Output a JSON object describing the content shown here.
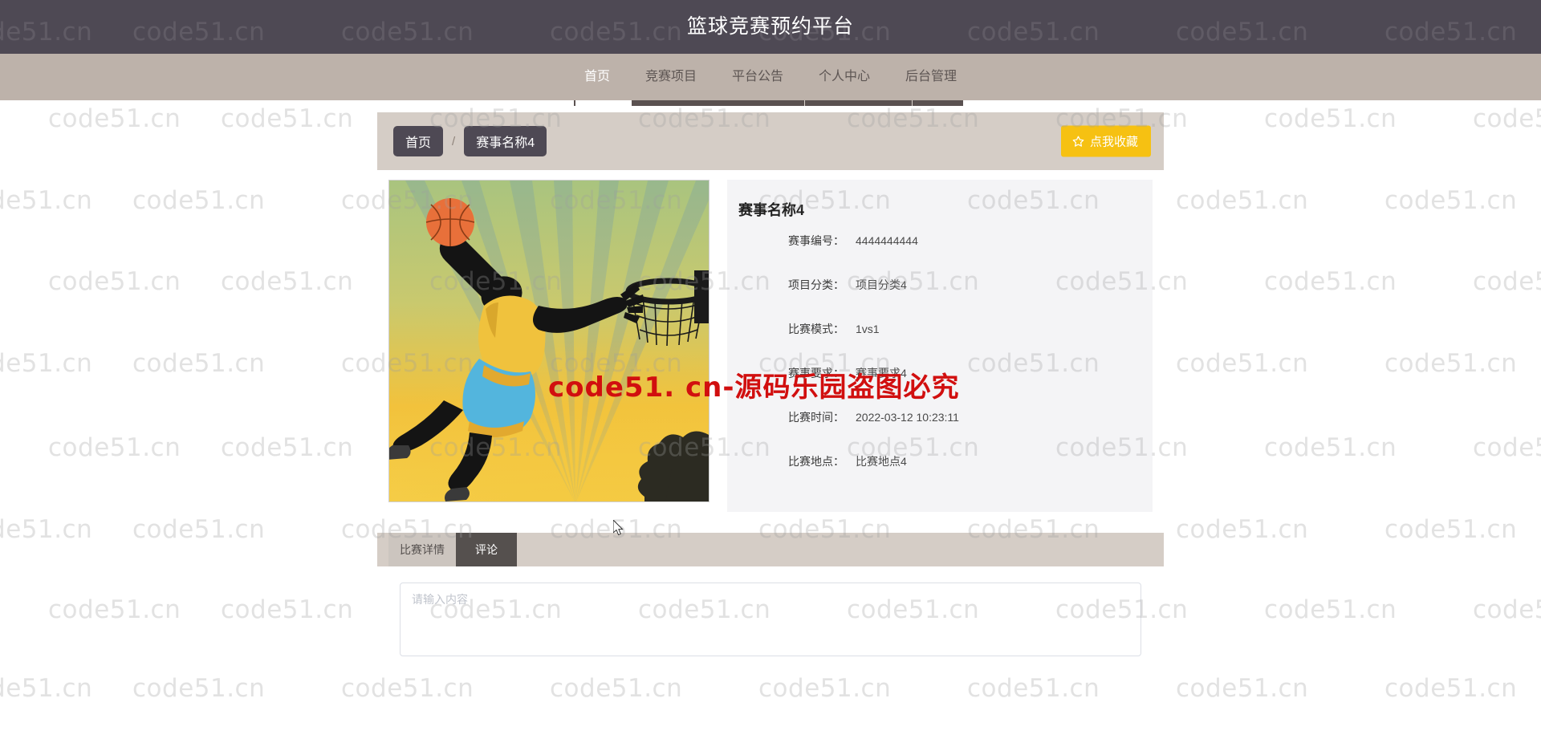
{
  "header": {
    "title": "篮球竞赛预约平台",
    "bg_color": "#4e4954"
  },
  "nav": {
    "bg_color": "#bdb2aa",
    "items": [
      {
        "label": "首页",
        "active": true
      },
      {
        "label": "竞赛项目",
        "active": false
      },
      {
        "label": "平台公告",
        "active": false
      },
      {
        "label": "个人中心",
        "active": false
      },
      {
        "label": "后台管理",
        "active": false
      }
    ]
  },
  "breadcrumb": {
    "items": [
      {
        "label": "首页"
      },
      {
        "label": "赛事名称4"
      }
    ],
    "separator": "/"
  },
  "favorite_button": {
    "label": "点我收藏",
    "icon": "star-icon",
    "bg_color": "#f6c112"
  },
  "detail": {
    "image_alt": "篮球扣篮插画",
    "title": "赛事名称4",
    "fields": [
      {
        "label": "赛事编号：",
        "value": "4444444444"
      },
      {
        "label": "项目分类：",
        "value": "项目分类4"
      },
      {
        "label": "比赛模式：",
        "value": "1vs1"
      },
      {
        "label": "赛事要求：",
        "value": "赛事要求4"
      },
      {
        "label": "比赛时间：",
        "value": "2022-03-12 10:23:11"
      },
      {
        "label": "比赛地点：",
        "value": "比赛地点4"
      }
    ]
  },
  "tabs": [
    {
      "label": "比赛详情",
      "active": false
    },
    {
      "label": "评论",
      "active": true
    }
  ],
  "comment": {
    "placeholder": "请输入内容",
    "value": ""
  },
  "watermark": {
    "text": "code51.cn",
    "red_text": "code51. cn-源码乐园盗图必究"
  }
}
